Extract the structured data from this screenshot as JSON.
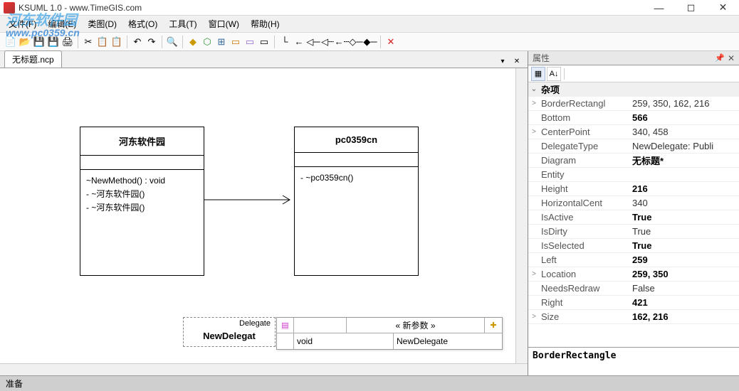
{
  "titlebar": {
    "title": "KSUML 1.0 - www.TimeGIS.com"
  },
  "watermark": {
    "line1": "河东软件园",
    "line2": "www.pc0359.cn"
  },
  "menubar": [
    "文件(F)",
    "编辑(E)",
    "类图(D)",
    "格式(O)",
    "工具(T)",
    "窗口(W)",
    "帮助(H)"
  ],
  "tab": {
    "label": "无标题.ncp"
  },
  "uml": {
    "box1": {
      "title": "河东软件园",
      "methods": [
        "~NewMethod() : void",
        "- ~河东软件园()",
        "- ~河东软件园()"
      ]
    },
    "box2": {
      "title": "pc0359cn",
      "methods": [
        "- ~pc0359cn()"
      ]
    },
    "delegate": {
      "stereotype": "Delegate",
      "name": "NewDelegat"
    }
  },
  "popup": {
    "header": "« 新参数 »",
    "ret": "void",
    "name": "NewDelegate"
  },
  "properties": {
    "panel_title": "属性",
    "category": "杂项",
    "rows": [
      {
        "exp": ">",
        "key": "BorderRectangl",
        "val": "259, 350, 162, 216",
        "bold": false
      },
      {
        "exp": "",
        "key": "Bottom",
        "val": "566",
        "bold": true
      },
      {
        "exp": ">",
        "key": "CenterPoint",
        "val": "340, 458",
        "bold": false
      },
      {
        "exp": "",
        "key": "DelegateType",
        "val": "NewDelegate: Publi",
        "bold": false
      },
      {
        "exp": "",
        "key": "Diagram",
        "val": "无标题*",
        "bold": true
      },
      {
        "exp": "",
        "key": "Entity",
        "val": "",
        "bold": false
      },
      {
        "exp": "",
        "key": "Height",
        "val": "216",
        "bold": true
      },
      {
        "exp": "",
        "key": "HorizontalCent",
        "val": "340",
        "bold": false
      },
      {
        "exp": "",
        "key": "IsActive",
        "val": "True",
        "bold": true
      },
      {
        "exp": "",
        "key": "IsDirty",
        "val": "True",
        "bold": false
      },
      {
        "exp": "",
        "key": "IsSelected",
        "val": "True",
        "bold": true
      },
      {
        "exp": "",
        "key": "Left",
        "val": "259",
        "bold": true
      },
      {
        "exp": ">",
        "key": "Location",
        "val": "259, 350",
        "bold": true
      },
      {
        "exp": "",
        "key": "NeedsRedraw",
        "val": "False",
        "bold": false
      },
      {
        "exp": "",
        "key": "Right",
        "val": "421",
        "bold": true
      },
      {
        "exp": ">",
        "key": "Size",
        "val": "162, 216",
        "bold": true
      }
    ],
    "desc": "BorderRectangle"
  },
  "statusbar": {
    "text": "准备"
  }
}
